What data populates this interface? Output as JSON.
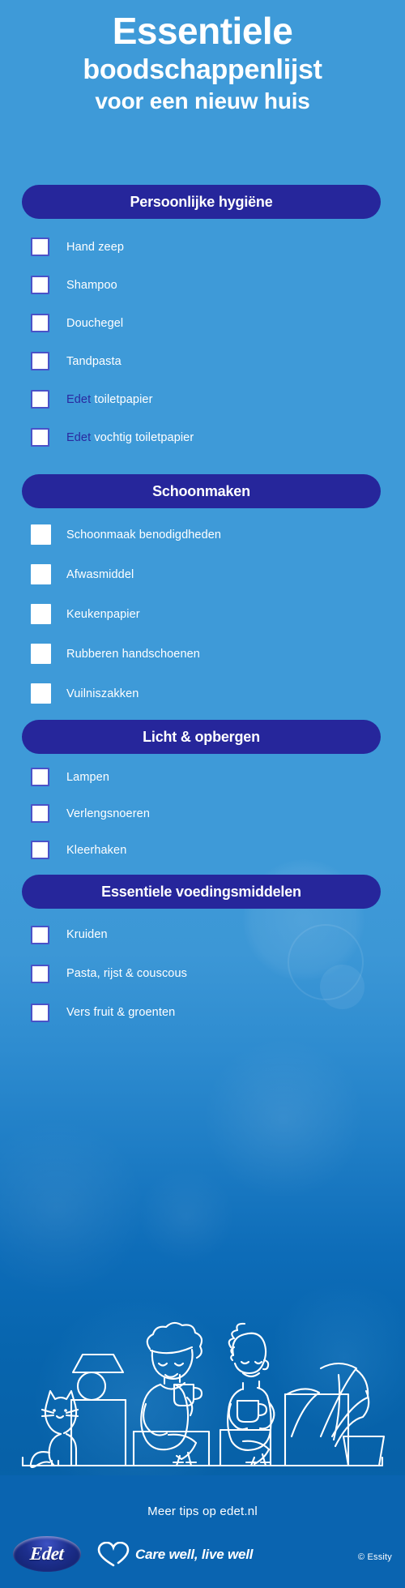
{
  "theme": {
    "background_blue": "#3e9ad8",
    "deep_blue": "#0a64b0",
    "navy_pill": "#26269b",
    "brand_navy": "#2a2aa0",
    "checkbox_border": "#4a52c8",
    "text_white": "#ffffff"
  },
  "title": {
    "line1": "Essentiele",
    "line2": "boodschappenlijst",
    "line3": "voor een nieuw huis"
  },
  "sections": [
    {
      "id": "persoonlijke-hygiene",
      "header": "Persoonlijke hygiëne",
      "checkbox_style": "bordered",
      "items": [
        {
          "label": "Hand zeep",
          "brand": "",
          "rest": "Hand zeep"
        },
        {
          "label": "Shampoo",
          "brand": "",
          "rest": "Shampoo"
        },
        {
          "label": "Douchegel",
          "brand": "",
          "rest": "Douchegel"
        },
        {
          "label": "Tandpasta",
          "brand": "",
          "rest": "Tandpasta"
        },
        {
          "label": "Edet toiletpapier",
          "brand": "Edet",
          "rest": " toiletpapier"
        },
        {
          "label": "Edet vochtig toiletpapier",
          "brand": "Edet",
          "rest": " vochtig toiletpapier"
        }
      ]
    },
    {
      "id": "schoonmaken",
      "header": "Schoonmaken",
      "checkbox_style": "plain",
      "items": [
        {
          "label": "Schoonmaak benodigdheden",
          "brand": "",
          "rest": "Schoonmaak benodigdheden"
        },
        {
          "label": "Afwasmiddel",
          "brand": "",
          "rest": "Afwasmiddel"
        },
        {
          "label": "Keukenpapier",
          "brand": "",
          "rest": "Keukenpapier"
        },
        {
          "label": "Rubberen handschoenen",
          "brand": "",
          "rest": "Rubberen handschoenen"
        },
        {
          "label": "Vuilniszakken",
          "brand": "",
          "rest": "Vuilniszakken"
        }
      ]
    },
    {
      "id": "licht-opbergen",
      "header": "Licht & opbergen",
      "checkbox_style": "bordered",
      "items": [
        {
          "label": "Lampen",
          "brand": "",
          "rest": "Lampen"
        },
        {
          "label": "Verlengsnoeren",
          "brand": "",
          "rest": "Verlengsnoeren"
        },
        {
          "label": "Kleerhaken",
          "brand": "",
          "rest": "Kleerhaken"
        }
      ]
    },
    {
      "id": "essentiele-voedingsmiddelen",
      "header": "Essentiele voedingsmiddelen",
      "checkbox_style": "bordered",
      "items": [
        {
          "label": "Kruiden",
          "brand": "",
          "rest": "Kruiden"
        },
        {
          "label": "Pasta, rijst & couscous",
          "brand": "",
          "rest": "Pasta, rijst & couscous"
        },
        {
          "label": "Vers fruit & groenten",
          "brand": "",
          "rest": "Vers fruit & groenten"
        }
      ]
    }
  ],
  "illustration": {
    "name": "living-room-line-art",
    "elements": [
      "cat",
      "table-lamp",
      "box",
      "woman-with-mug",
      "man-with-mug",
      "potted-plant",
      "floor-line"
    ]
  },
  "footer": {
    "tagline": "Meer tips op edet.nl",
    "brand_logo_text": "Edet",
    "care_slogan": "Care well, live well",
    "copyright": "© Essity"
  }
}
